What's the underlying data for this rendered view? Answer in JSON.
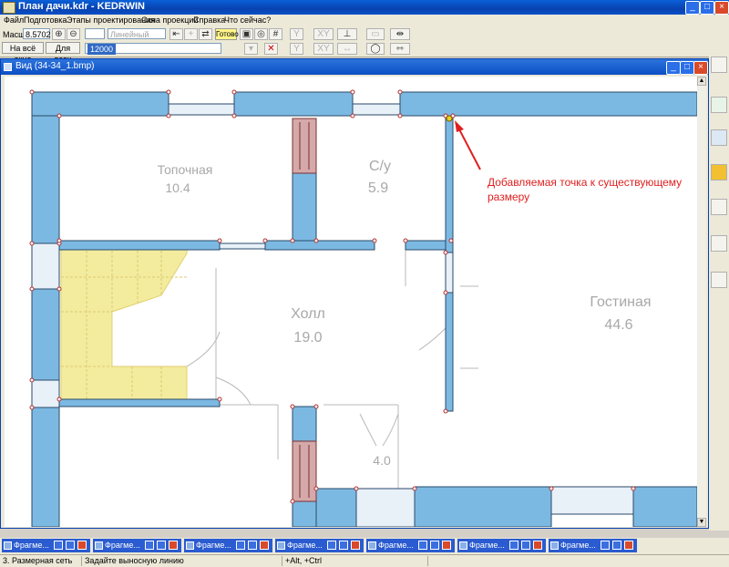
{
  "app": {
    "title": "План дачи.kdr - KEDRWIN"
  },
  "menu": [
    "Файл",
    "Подготовка",
    "Этапы проектирования",
    "Окна проекций",
    "Справка",
    "Что сейчас?"
  ],
  "toolbar": {
    "scale_label": "Масшт",
    "scale_value": "8.5702",
    "fit_all_button": "На всё окно",
    "for_all_button": "Для всех",
    "line_type": "Линейный",
    "ready_button": "Готово",
    "value_field": "12000"
  },
  "document": {
    "title": "Вид (34-34_1.bmp)"
  },
  "plan": {
    "rooms": [
      {
        "name": "Топочная",
        "area": "10.4"
      },
      {
        "name": "С/у",
        "area": "5.9"
      },
      {
        "name": "Холл",
        "area": "19.0"
      },
      {
        "name": "Гостиная",
        "area": "44.6"
      },
      {
        "area": "4.0"
      }
    ],
    "annotation": "Добавляемая точка к существующему размеру"
  },
  "fragments": [
    "Фрагме...",
    "Фрагме...",
    "Фрагме...",
    "Фрагме...",
    "Фрагме...",
    "Фрагме...",
    "Фрагме..."
  ],
  "status": {
    "grid": "3. Размерная сеть",
    "hint": "Задайте выносную линию",
    "keys": "+Alt, +Ctrl"
  },
  "colors": {
    "wall": "#7cb9e2",
    "stairs": "#f3ec9e",
    "chimney": "#d5a9a9",
    "annotation": "#e02020"
  }
}
